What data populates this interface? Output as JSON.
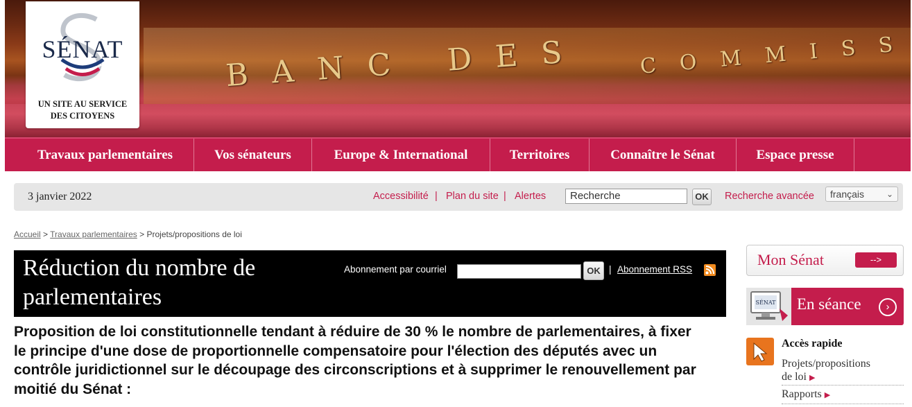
{
  "header": {
    "logo_name": "SÉNAT",
    "logo_tagline_1": "UN SITE AU SERVICE",
    "logo_tagline_2": "DES CITOYENS",
    "plate_1": "BANC",
    "plate_2": "DES",
    "plate_3": "COMMISSIONS"
  },
  "nav": {
    "items": [
      {
        "label": "Travaux parlementaires"
      },
      {
        "label": "Vos sénateurs"
      },
      {
        "label": "Europe & International"
      },
      {
        "label": "Territoires"
      },
      {
        "label": "Connaître le Sénat"
      },
      {
        "label": "Espace presse"
      }
    ]
  },
  "utility": {
    "date": "3 janvier 2022",
    "accessibility": "Accessibilité",
    "sitemap": "Plan du site",
    "alerts": "Alertes",
    "separator": "|",
    "search_placeholder": "Recherche",
    "ok_label": "OK",
    "advanced_search": "Recherche avancée",
    "language": "français"
  },
  "breadcrumb": {
    "home": "Accueil",
    "sep": ">",
    "section": "Travaux parlementaires",
    "current": "Projets/propositions de loi"
  },
  "page": {
    "title": "Réduction du nombre de parlementaires",
    "subscribe_label": "Abonnement par courriel",
    "ok_label": "OK",
    "sep": "|",
    "rss_label": "Abonnement RSS",
    "description": "Proposition de loi constitutionnelle tendant à réduire de 30 % le nombre de parlementaires, à fixer le principe d'une dose de proportionnelle compensatoire pour l'élection des députés avec un contrôle juridictionnel sur le découpage des circonscriptions et à supprimer le renouvellement par moitié du Sénat :"
  },
  "sidebar": {
    "mon_senat": "Mon Sénat",
    "mon_senat_arrow": "-->",
    "en_seance": "En séance",
    "acces_rapide": "Accès rapide",
    "acces_items": [
      {
        "label_1": "Projets/propositions",
        "label_2": "de loi"
      },
      {
        "label_1": "Rapports"
      }
    ]
  },
  "colors": {
    "brand": "#c41d4c",
    "title_bg": "#000000",
    "accent_orange": "#e8741e"
  }
}
